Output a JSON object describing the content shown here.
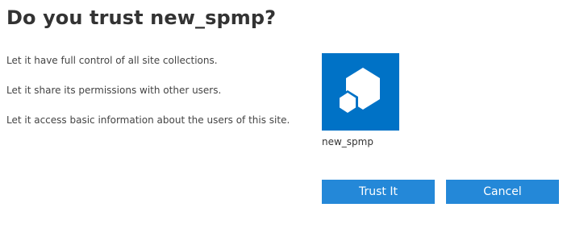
{
  "dialog": {
    "title": "Do you trust new_spmp?",
    "permissions": [
      "Let it have full control of all site collections.",
      "Let it share its permissions with other users.",
      "Let it access basic information about the users of this site."
    ]
  },
  "app": {
    "name": "new_spmp",
    "icon": "app-cubes-icon",
    "tile_color": "#0072c6"
  },
  "buttons": {
    "trust_label": "Trust It",
    "cancel_label": "Cancel",
    "button_color": "#2488d8"
  }
}
